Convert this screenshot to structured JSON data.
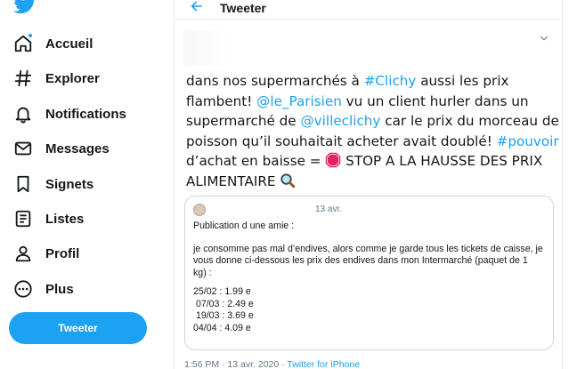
{
  "sidebar": {
    "logo_icon": "twitter-bird-icon",
    "items": [
      {
        "label": "Accueil",
        "icon": "home-icon"
      },
      {
        "label": "Explorer",
        "icon": "hashtag-icon"
      },
      {
        "label": "Notifications",
        "icon": "bell-icon"
      },
      {
        "label": "Messages",
        "icon": "envelope-icon"
      },
      {
        "label": "Signets",
        "icon": "bookmark-icon"
      },
      {
        "label": "Listes",
        "icon": "list-icon"
      },
      {
        "label": "Profil",
        "icon": "person-icon"
      },
      {
        "label": "Plus",
        "icon": "more-circle-icon"
      }
    ],
    "tweet_button": "Tweeter"
  },
  "header": {
    "back_icon": "arrow-left-icon",
    "title": "Tweeter"
  },
  "tweet": {
    "text": {
      "l1_a": "dans nos supermarchés à ",
      "l1_link": "#Clichy",
      "l1_b": " aussi les prix",
      "l2_a": "flambent! ",
      "l2_link": "@le_Parisien",
      "l2_b": " vu un client hurler dans un",
      "l3_a": "supermarché de ",
      "l3_link": "@villeclichy",
      "l3_b": " car le prix du morceau de",
      "l4_a": "poisson qu’il souhaitait acheter avait doublé!  ",
      "l4_link": "#pouvoir",
      "l5_a": " d’achat en baisse = ",
      "l5_b": " STOP A LA HAUSSE DES PRIX",
      "l6_a": "ALIMENTAIRE "
    },
    "emojis": [
      "stop-sign-icon",
      "magnifying-glass-icon"
    ],
    "quote": {
      "date": "13 avr.",
      "lines": [
        "Publication d une amie :",
        "",
        "je consomme pas mal d’endives, alors comme je garde tous les tickets de caisse, je",
        "vous donne ci-dessous les prix des endives dans mon Intermarché (paquet de 1",
        "kg) :",
        "",
        "25/02 : 1.99 e",
        " 07/03 : 2.49 e",
        " 19/03 : 3.69 e",
        "04/04 : 4.09 e"
      ]
    },
    "meta": {
      "time_date": "1:56 PM · 13 avr. 2020 · ",
      "app": "Twitter for iPhone"
    }
  },
  "colors": {
    "accent": "#1da1f2",
    "text": "#14171a",
    "muted": "#657786",
    "border": "#e6ecf0"
  }
}
